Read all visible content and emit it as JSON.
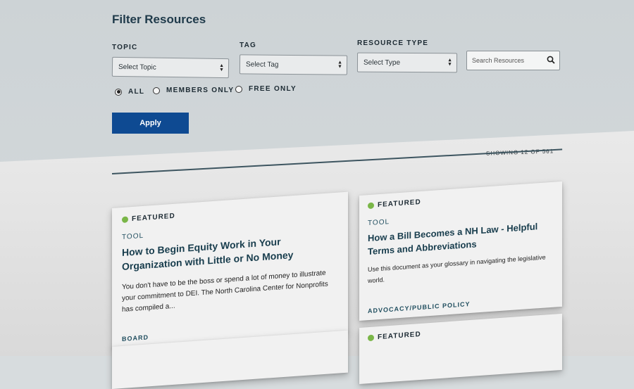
{
  "filters": {
    "title": "Filter Resources",
    "topic_label": "TOPIC",
    "topic_value": "Select Topic",
    "tag_label": "TAG",
    "tag_value": "Select Tag",
    "type_label": "RESOURCE TYPE",
    "type_value": "Select Type",
    "search_placeholder": "Search Resources",
    "radios": [
      {
        "label": "ALL",
        "selected": true
      },
      {
        "label": "MEMBERS ONLY",
        "selected": false
      },
      {
        "label": "FREE ONLY",
        "selected": false
      }
    ],
    "apply_label": "Apply"
  },
  "results": {
    "showing": "SHOWING 12 OF 561"
  },
  "cards": [
    {
      "featured": "FEATURED",
      "type": "TOOL",
      "title": "How to Begin Equity Work in Your Organization with Little or No Money",
      "description": "You don't have to be the boss or spend a lot of money to illustrate your commitment to DEI. The North Carolina Center for Nonprofits has compiled a...",
      "tag": "BOARD"
    },
    {
      "featured": "FEATURED",
      "type": "TOOL",
      "title": "How a Bill Becomes a NH Law - Helpful Terms and Abbreviations",
      "description": "Use this document as your glossary in navigating the legislative world.",
      "tag": "ADVOCACY/PUBLIC POLICY"
    },
    {
      "featured": "FEATURED"
    }
  ],
  "colors": {
    "accent": "#0e4a92",
    "featured_dot": "#7ab648"
  }
}
